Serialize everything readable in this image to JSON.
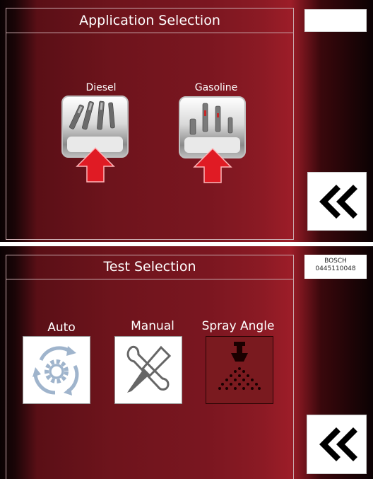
{
  "top": {
    "title": "Application Selection",
    "apps": [
      {
        "label": "Diesel",
        "icon": "diesel-injectors-icon"
      },
      {
        "label": "Gasoline",
        "icon": "gasoline-injectors-icon"
      }
    ],
    "back_icon": "double-chevron-left-icon"
  },
  "bottom": {
    "title": "Test Selection",
    "injector_brand": "BOSCH",
    "injector_part": "0445110048",
    "tests": [
      {
        "label": "Auto",
        "icon": "auto-cycle-gear-icon"
      },
      {
        "label": "Manual",
        "icon": "wrench-screwdriver-icon"
      },
      {
        "label": "Spray Angle",
        "icon": "spray-nozzle-icon"
      }
    ],
    "back_icon": "double-chevron-left-icon"
  },
  "colors": {
    "accent_red": "#e01b24",
    "background_dark": "#0a0203",
    "background_red": "#8b1a24"
  }
}
